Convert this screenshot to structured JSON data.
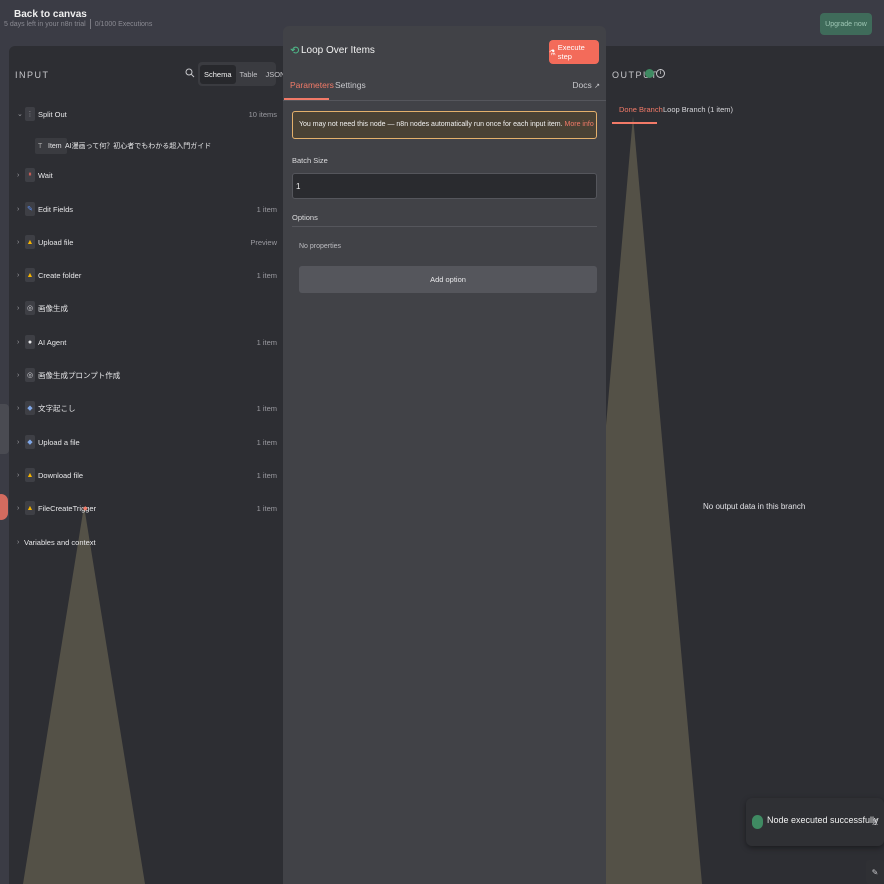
{
  "topbar": {
    "back_label": "Back to canvas",
    "trial_text": "5 days left in your n8n trial",
    "executions": "0/1000 Executions",
    "upgrade_label": "Upgrade now"
  },
  "input": {
    "title": "INPUT",
    "tabs": [
      "Schema",
      "Table",
      "JSON"
    ],
    "active_tab": "Schema",
    "nodes": [
      {
        "label": "Split Out",
        "count": "10 items",
        "icon": "split-icon",
        "color": "#9a9aa0"
      },
      {
        "label": "Item",
        "value": "AI漫画って何？初心者でもわかる超入門ガイド",
        "icon": "text-type-icon"
      },
      {
        "label": "Wait",
        "count": "",
        "icon": "pause-icon",
        "color": "#e0625a"
      },
      {
        "label": "Edit Fields",
        "count": "1 item",
        "icon": "pencil-icon",
        "color": "#5b8def"
      },
      {
        "label": "Upload file",
        "count": "Preview",
        "icon": "drive-icon",
        "color": "#f6b400"
      },
      {
        "label": "Create folder",
        "count": "1 item",
        "icon": "drive-icon",
        "color": "#f6b400"
      },
      {
        "label": "画像生成",
        "count": "",
        "icon": "openai-icon",
        "color": "#d8d8dc"
      },
      {
        "label": "AI Agent",
        "count": "1 item",
        "icon": "robot-icon",
        "color": "#e8e8ea"
      },
      {
        "label": "画像生成プロンプト作成",
        "count": "",
        "icon": "openai-icon",
        "color": "#d8d8dc"
      },
      {
        "label": "文字起こし",
        "count": "1 item",
        "icon": "diamond-icon",
        "color": "#7fa7e8"
      },
      {
        "label": "Upload a file",
        "count": "1 item",
        "icon": "diamond-icon",
        "color": "#7fa7e8"
      },
      {
        "label": "Download file",
        "count": "1 item",
        "icon": "drive-icon",
        "color": "#f6b400"
      },
      {
        "label": "FileCreateTrigger",
        "count": "1 item",
        "icon": "drive-icon",
        "color": "#f6b400"
      }
    ],
    "variables_label": "Variables and context"
  },
  "node": {
    "title": "Loop Over Items",
    "execute_label": "Execute step",
    "tabs": [
      "Parameters",
      "Settings"
    ],
    "docs_label": "Docs",
    "notice_text": "You may not need this node — n8n nodes automatically run once for each input item.",
    "notice_link": "More info",
    "batch_label": "Batch Size",
    "batch_value": "1",
    "options_label": "Options",
    "no_properties": "No properties",
    "add_option_label": "Add option"
  },
  "output": {
    "title": "OUTPUT",
    "tabs": [
      "Done Branch",
      "Loop Branch (1 item)"
    ],
    "empty_text": "No output data in this branch"
  },
  "toast": {
    "text": "Node executed successfully",
    "close": "X"
  },
  "colors": {
    "accent": "#f36b5a",
    "success": "#3f8a62",
    "panel": "#2d2e33",
    "tan": "#545147"
  }
}
